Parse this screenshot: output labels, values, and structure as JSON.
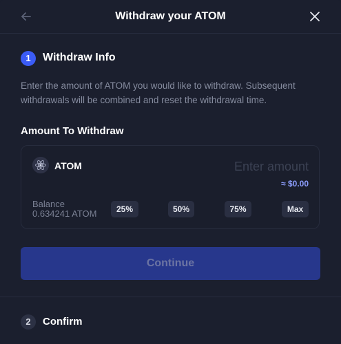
{
  "header": {
    "title": "Withdraw your ATOM",
    "back_icon": "arrow-left-icon",
    "close_icon": "close-icon"
  },
  "steps": [
    {
      "number": "1",
      "label": "Withdraw Info",
      "active": true
    },
    {
      "number": "2",
      "label": "Confirm",
      "active": false
    }
  ],
  "withdraw_info": {
    "description": "Enter the amount of ATOM you would like to withdraw. Subsequent withdrawals will be combined and reset the withdrawal time.",
    "amount_label": "Amount To Withdraw",
    "token": {
      "name": "ATOM",
      "icon": "cosmos-atom-icon"
    },
    "input": {
      "value": "",
      "placeholder": "Enter amount"
    },
    "usd_value": "≈ $0.00",
    "balance": {
      "label": "Balance",
      "value": "0.634241 ATOM"
    },
    "presets": [
      "25%",
      "50%",
      "75%",
      "Max"
    ]
  },
  "continue_label": "Continue",
  "colors": {
    "background": "#1b1f2e",
    "accent": "#3b5cf6",
    "continue_disabled_bg": "#27378c",
    "usd_text": "#8b9cfb"
  }
}
